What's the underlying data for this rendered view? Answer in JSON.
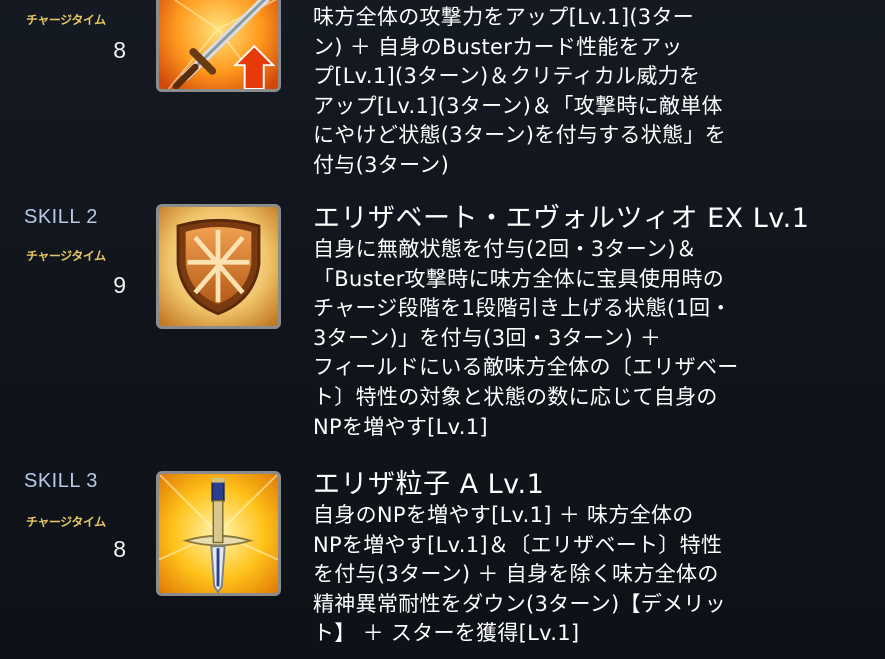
{
  "skills": [
    {
      "id_label": "",
      "charge_label": "チャージタイム",
      "charge_value": "8",
      "icon": "sword-attack-up-icon",
      "name": "",
      "desc_lines": [
        "味方全体の攻撃力をアップ[Lv.1](3ター",
        "ン) ＋ 自身のBusterカード性能をアッ",
        "プ[Lv.1](3ターン)＆クリティカル威力を",
        "アップ[Lv.1](3ターン)＆「攻撃時に敵単体",
        "にやけど状態(3ターン)を付与する状態」を",
        "付与(3ターン)"
      ]
    },
    {
      "id_label": "SKILL 2",
      "charge_label": "チャージタイム",
      "charge_value": "9",
      "icon": "shield-icon",
      "name": "エリザベート・エヴォルツィオ EX Lv.1",
      "desc_lines": [
        "自身に無敵状態を付与(2回・3ターン)＆",
        "「Buster攻撃時に味方全体に宝具使用時の",
        "チャージ段階を1段階引き上げる状態(1回・",
        "3ターン)」を付与(3回・3ターン) ＋",
        "フィールドにいる敵味方全体の〔エリザベー",
        "ト〕特性の対象と状態の数に応じて自身の",
        "NPを増やす[Lv.1]"
      ]
    },
    {
      "id_label": "SKILL 3",
      "charge_label": "チャージタイム",
      "charge_value": "8",
      "icon": "sword-np-icon",
      "name": "エリザ粒子 A Lv.1",
      "desc_lines": [
        "自身のNPを増やす[Lv.1] ＋ 味方全体の",
        "NPを増やす[Lv.1]＆〔エリザベート〕特性",
        "を付与(3ターン) ＋ 自身を除く味方全体の",
        "精神異常耐性をダウン(3ターン)【デメリッ",
        "ト】 ＋ スターを獲得[Lv.1]"
      ]
    }
  ],
  "colors": {
    "background": "#11161d",
    "skill_id": "#b9c9e8",
    "charge_label": "#e6c766",
    "text": "#ffffff"
  }
}
